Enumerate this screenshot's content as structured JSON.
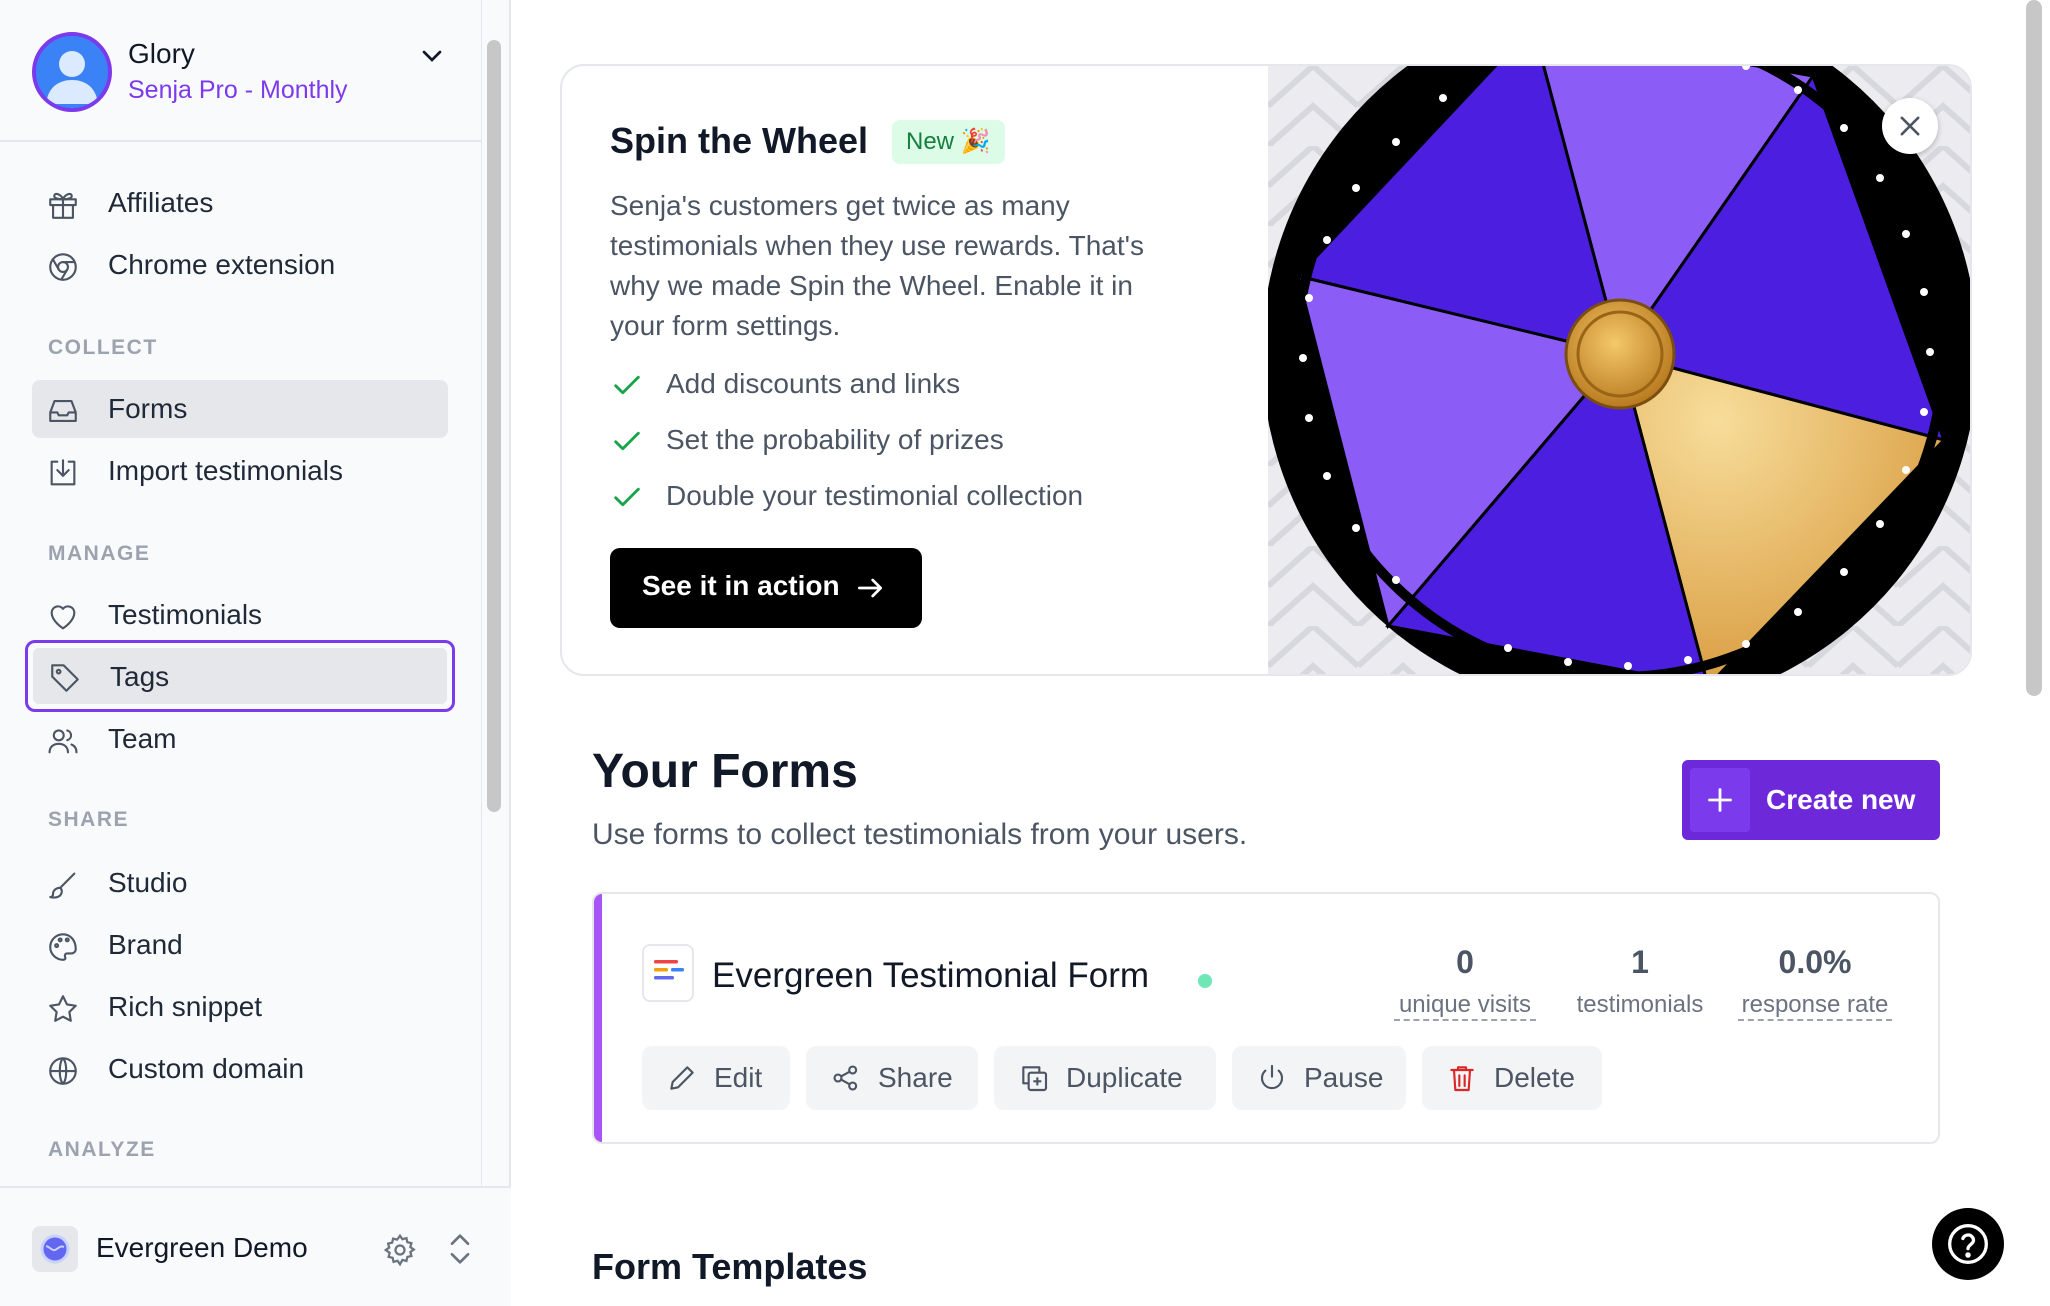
{
  "account": {
    "name": "Glory",
    "plan": "Senja Pro - Monthly"
  },
  "sidebar": {
    "top_items": [
      {
        "label": "Affiliates",
        "icon": "gift-icon"
      },
      {
        "label": "Chrome extension",
        "icon": "chrome-icon"
      }
    ],
    "sections": {
      "collect": "COLLECT",
      "manage": "MANAGE",
      "share": "SHARE",
      "analyze": "ANALYZE"
    },
    "collect_items": [
      {
        "label": "Forms",
        "icon": "inbox-icon",
        "active": true
      },
      {
        "label": "Import testimonials",
        "icon": "import-icon"
      }
    ],
    "manage_items": [
      {
        "label": "Testimonials",
        "icon": "heart-icon"
      },
      {
        "label": "Tags",
        "icon": "tag-icon",
        "focused": true
      },
      {
        "label": "Team",
        "icon": "users-icon"
      }
    ],
    "share_items": [
      {
        "label": "Studio",
        "icon": "brush-icon"
      },
      {
        "label": "Brand",
        "icon": "palette-icon"
      },
      {
        "label": "Rich snippet",
        "icon": "star-icon"
      },
      {
        "label": "Custom domain",
        "icon": "globe-icon"
      }
    ],
    "workspace": {
      "name": "Evergreen Demo"
    }
  },
  "promo": {
    "title": "Spin the Wheel",
    "badge": "New 🎉",
    "description": "Senja's customers get twice as many testimonials when they use rewards. That's why we made Spin the Wheel. Enable it in your form settings.",
    "features": [
      "Add discounts and links",
      "Set the probability of prizes",
      "Double your testimonial collection"
    ],
    "cta_label": "See it in action"
  },
  "forms": {
    "title": "Your Forms",
    "subtitle": "Use forms to collect testimonials from your users.",
    "create_label": "Create new",
    "items": [
      {
        "name": "Evergreen Testimonial Form",
        "stats": [
          {
            "value": "0",
            "label": "unique visits"
          },
          {
            "value": "1",
            "label": "testimonials"
          },
          {
            "value": "0.0%",
            "label": "response rate"
          }
        ],
        "actions": [
          "Edit",
          "Share",
          "Duplicate",
          "Pause",
          "Delete"
        ]
      }
    ]
  },
  "templates": {
    "title": "Form Templates"
  },
  "colors": {
    "accent": "#7c3aed",
    "primary_button": "#6d28d9",
    "success": "#16a34a",
    "danger": "#dc2626",
    "wheel_purple_dark": "#4c1fe0",
    "wheel_purple_light": "#8b5cf6",
    "wheel_gold": "#e3a549"
  }
}
